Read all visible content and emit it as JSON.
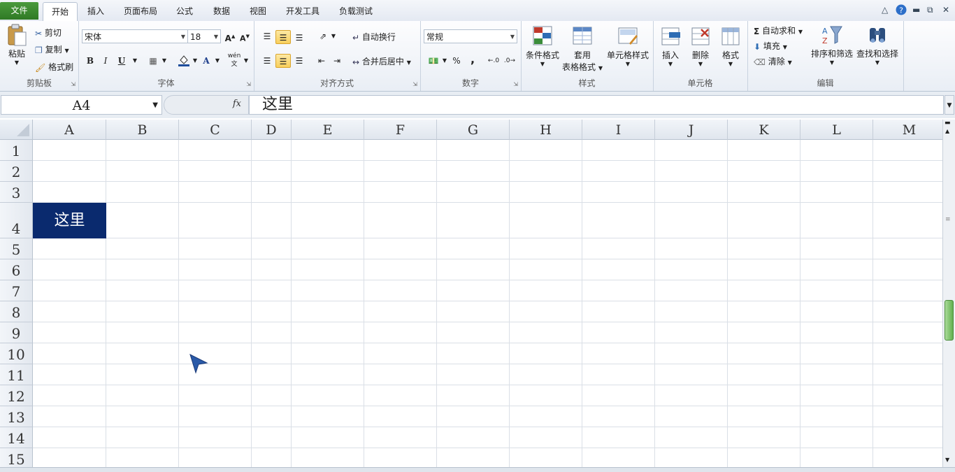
{
  "tabs": {
    "file": "文件",
    "items": [
      "开始",
      "插入",
      "页面布局",
      "公式",
      "数据",
      "视图",
      "开发工具",
      "负载测试"
    ],
    "active": "开始"
  },
  "ribbon": {
    "clipboard": {
      "label": "剪贴板",
      "paste": "粘贴",
      "cut": "剪切",
      "copy": "复制",
      "format_painter": "格式刷"
    },
    "font": {
      "label": "字体",
      "font_name": "宋体",
      "font_size": "18",
      "bold": "B",
      "italic": "I",
      "underline": "U",
      "font_color_glyph": "A",
      "phonetic": "wén"
    },
    "alignment": {
      "label": "对齐方式",
      "wrap_text": "自动换行",
      "merge_center": "合并后居中"
    },
    "number": {
      "label": "数字",
      "format": "常规",
      "percent": "%",
      "comma": ","
    },
    "styles": {
      "label": "样式",
      "conditional": "条件格式",
      "table_format_1": "套用",
      "table_format_2": "表格格式",
      "cell_styles": "单元格样式"
    },
    "cells": {
      "label": "单元格",
      "insert": "插入",
      "delete": "删除",
      "format": "格式"
    },
    "editing": {
      "label": "编辑",
      "autosum": "自动求和",
      "fill": "填充",
      "clear": "清除",
      "sort_filter": "排序和筛选",
      "find_select": "查找和选择"
    }
  },
  "formula_bar": {
    "name_box": "A4",
    "fx": "fx",
    "content": "这里"
  },
  "grid": {
    "columns": [
      "A",
      "B",
      "C",
      "D",
      "E",
      "F",
      "G",
      "H",
      "I",
      "J",
      "K",
      "L",
      "M"
    ],
    "rows": [
      "1",
      "2",
      "3",
      "4",
      "5",
      "6",
      "7",
      "8",
      "9",
      "10",
      "11",
      "12",
      "13",
      "14",
      "15"
    ],
    "selected_cell_text": "这里"
  },
  "colors": {
    "accent_file_tab": "#2f7a25",
    "selected_cell_bg": "#0a2a6e"
  }
}
